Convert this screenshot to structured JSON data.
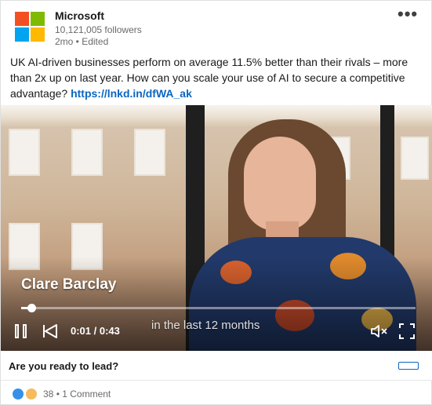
{
  "post": {
    "company": "Microsoft",
    "followers": "10,121,005 followers",
    "meta": "2mo • Edited",
    "text": "UK AI-driven businesses perform on average 11.5% better than their rivals – more than 2x up on last year. How can you scale your use of AI to secure a competitive advantage? ",
    "link_text": "https://lnkd.in/dfWA_ak"
  },
  "video": {
    "speaker_name": "Clare Barclay",
    "caption": "in the last 12 months",
    "time": "0:01 / 0:43",
    "progress": 0.02
  },
  "cta": {
    "text": "Are you ready to lead?"
  },
  "social": {
    "reactions": "38",
    "separator": " • ",
    "comments": "1 Comment"
  },
  "colors": {
    "logo_red": "#f25022",
    "logo_green": "#7fba00",
    "logo_blue": "#00a4ef",
    "logo_yellow": "#ffb900",
    "link": "#0a66c2"
  },
  "icons": [
    "microsoft-logo",
    "more-options-icon",
    "pause-icon",
    "previous-icon",
    "mute-icon",
    "fullscreen-icon",
    "like-icon",
    "insightful-icon"
  ]
}
